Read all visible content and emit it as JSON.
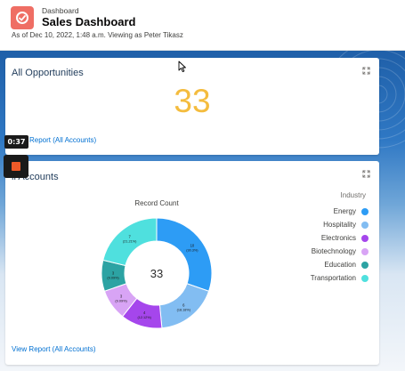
{
  "header": {
    "eyebrow": "Dashboard",
    "title": "Sales Dashboard",
    "subtitle": "As of Dec 10, 2022, 1:48 a.m. Viewing as Peter Tikasz",
    "icon": "dashboard-icon",
    "icon_color": "#ef6e64"
  },
  "opportunities_card": {
    "title": "All Opportunities",
    "metric": "33",
    "metric_color": "#f4bc3e",
    "link": "Report (All Accounts)"
  },
  "accounts_card": {
    "title": "All Accounts",
    "title_visible": "ll Accounts",
    "link": "View Report (All Accounts)",
    "chart_title": "Record Count",
    "center_total": "33",
    "legend_title": "Industry"
  },
  "chart_data": {
    "type": "pie",
    "title": "Record Count",
    "legend_title": "Industry",
    "total": 33,
    "series": [
      {
        "name": "Energy",
        "value": 10,
        "label_pct": "(30.3%)",
        "color": "#2d9cf5"
      },
      {
        "name": "Hospitality",
        "value": 6,
        "label_pct": "(18.18%)",
        "color": "#82bdf2"
      },
      {
        "name": "Electronics",
        "value": 4,
        "label_pct": "(12.12%)",
        "color": "#a546ec"
      },
      {
        "name": "Biotechnology",
        "value": 3,
        "label_pct": "(9.09%)",
        "color": "#d8a4f5"
      },
      {
        "name": "Education",
        "value": 3,
        "label_pct": "(9.09%)",
        "color": "#2ca3a3"
      },
      {
        "name": "Transportation",
        "value": 7,
        "label_pct": "(21.21%)",
        "color": "#4fe0de"
      }
    ]
  },
  "overlay": {
    "timer": "0:37",
    "stop_color": "#f05a28"
  }
}
